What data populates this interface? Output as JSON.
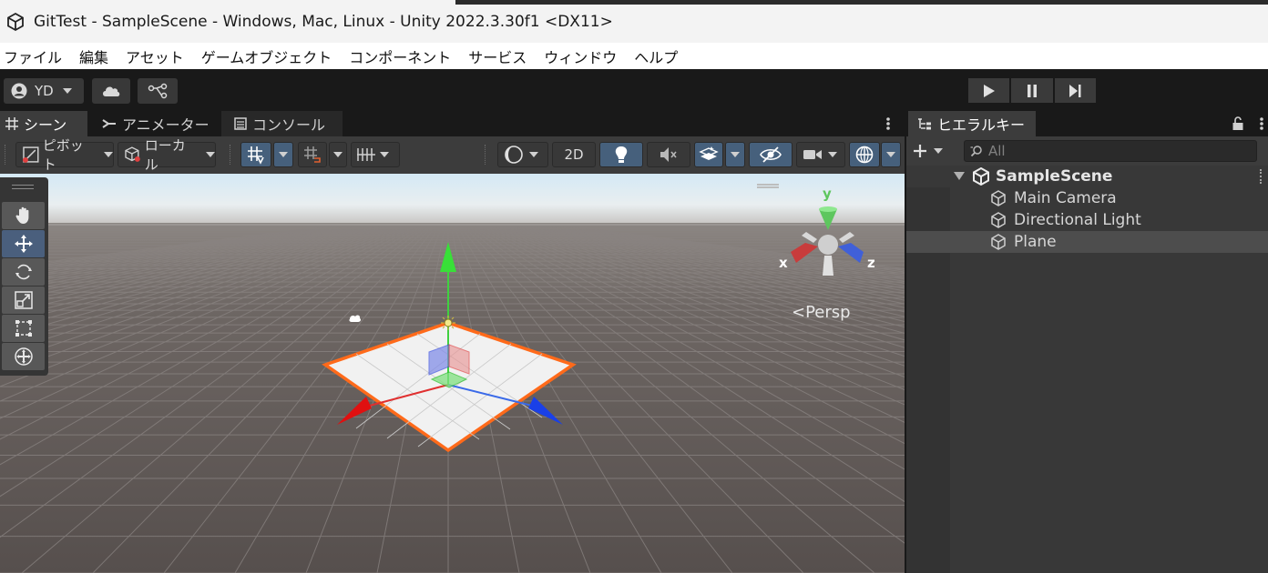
{
  "window": {
    "title": "GitTest - SampleScene - Windows, Mac, Linux - Unity 2022.3.30f1 <DX11>"
  },
  "menu": [
    "ファイル",
    "編集",
    "アセット",
    "ゲームオブジェクト",
    "コンポーネント",
    "サービス",
    "ウィンドウ",
    "ヘルプ"
  ],
  "toolbar": {
    "account": "YD",
    "account_icon": "account-icon",
    "cloud_icon": "cloud-icon",
    "collab_icon": "version-control-icon",
    "play_icon": "play-icon",
    "pause_icon": "pause-icon",
    "step_icon": "step-icon"
  },
  "scene_tabs": [
    {
      "label": "シーン",
      "icon": "grid-icon",
      "active": true
    },
    {
      "label": "アニメーター",
      "icon": "animator-icon",
      "active": false
    },
    {
      "label": "コンソール",
      "icon": "console-icon",
      "active": false
    }
  ],
  "scene_toolbar": {
    "pivot": "ピボット",
    "local": "ローカル",
    "mode_2d": "2D"
  },
  "viewport": {
    "projection": "Persp",
    "axis_x": "x",
    "axis_y": "y",
    "axis_z": "z",
    "active_tool": "move"
  },
  "hierarchy": {
    "tab": "ヒエラルキー",
    "search_placeholder": "All",
    "scene": "SampleScene",
    "items": [
      {
        "label": "Main Camera",
        "selected": false
      },
      {
        "label": "Directional Light",
        "selected": false
      },
      {
        "label": "Plane",
        "selected": true
      }
    ]
  },
  "colors": {
    "selection_outline": "#ff6a1a",
    "axis_x": "#e03030",
    "axis_y": "#40d040",
    "axis_z": "#2a50e0",
    "tool_active": "#4a5f7d"
  }
}
